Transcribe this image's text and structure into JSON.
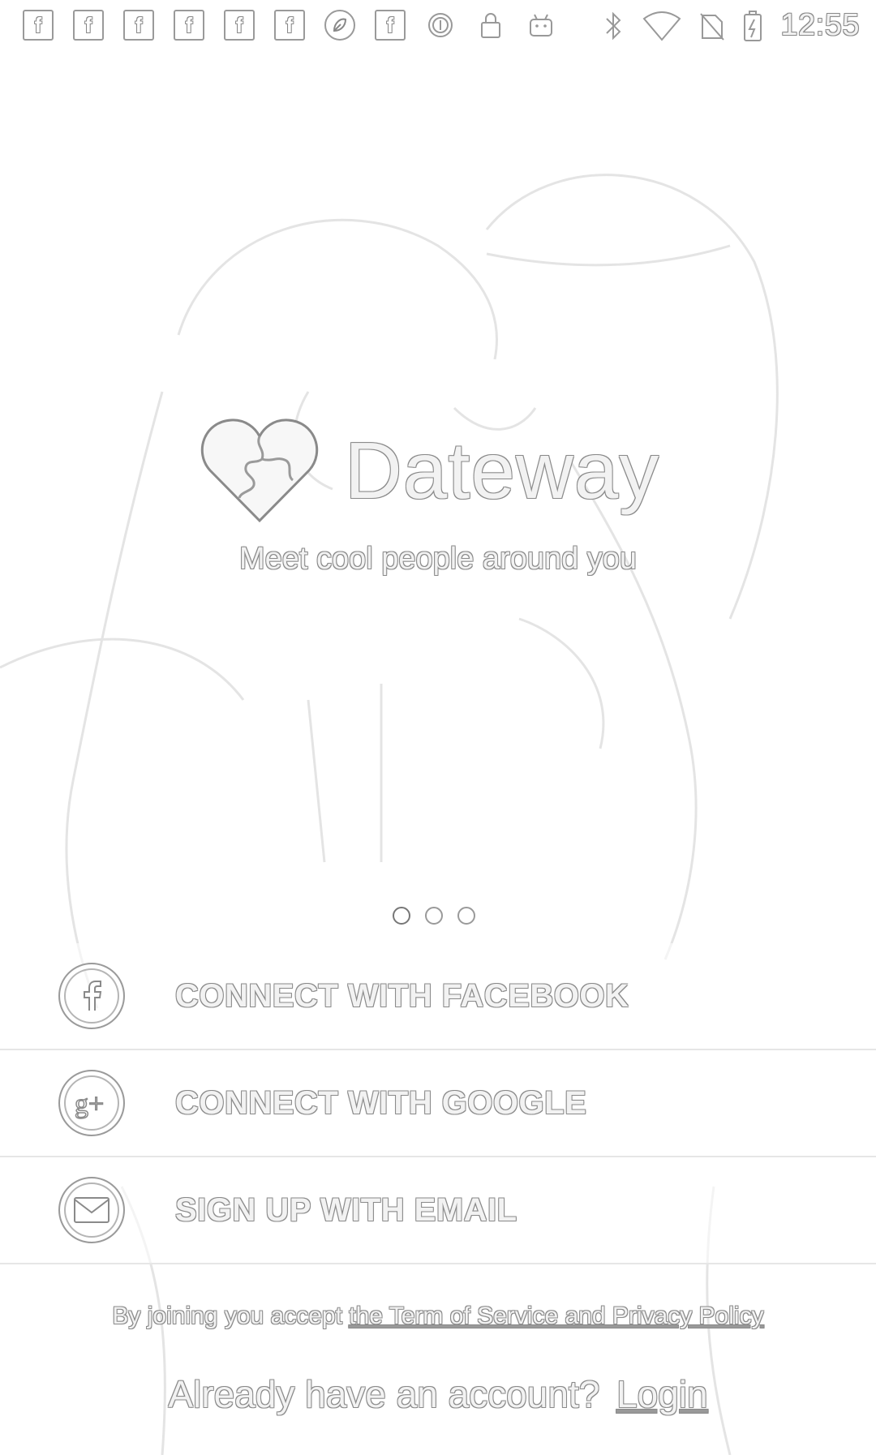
{
  "status_bar": {
    "notification_icons": [
      "facebook-icon",
      "facebook-icon",
      "facebook-icon",
      "facebook-icon",
      "facebook-icon",
      "facebook-icon",
      "app-icon",
      "facebook-icon",
      "data-saver-icon",
      "lock-icon",
      "android-icon"
    ],
    "notification_glyphs": {
      "facebook": "f"
    },
    "system_icons": [
      "bluetooth-icon",
      "wifi-icon",
      "no-sim-icon",
      "battery-icon"
    ],
    "time": "12:55"
  },
  "app": {
    "name": "Dateway",
    "tagline": "Meet cool people around you",
    "logo_icon": "puzzle-heart-icon"
  },
  "pager": {
    "count": 3,
    "active": 0
  },
  "actions": [
    {
      "label": "CONNECT WITH FACEBOOK",
      "icon": "facebook-icon"
    },
    {
      "label": "CONNECT WITH GOOGLE",
      "icon": "google-plus-icon"
    },
    {
      "label": "SIGN UP WITH EMAIL",
      "icon": "email-icon"
    }
  ],
  "terms": {
    "prefix": "By joining you accept ",
    "link": "the Term of Service and Privacy Policy"
  },
  "login": {
    "prompt": "Already have an account?",
    "link": "Login"
  }
}
